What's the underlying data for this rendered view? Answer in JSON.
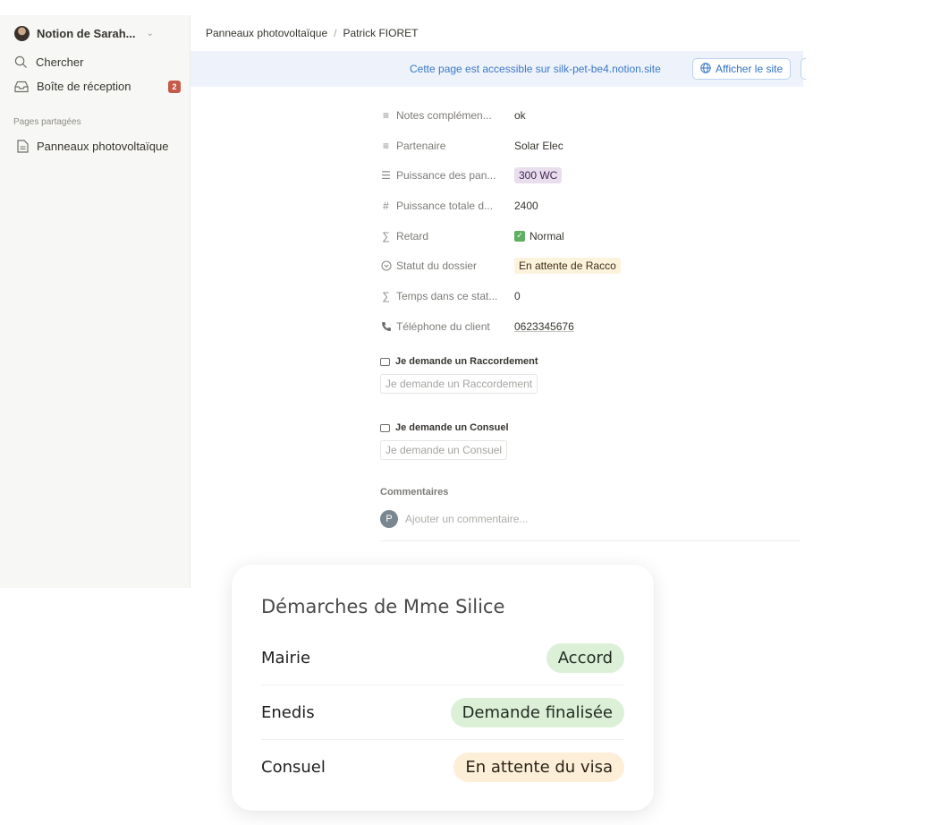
{
  "sidebar": {
    "workspace": "Notion de Sarah...",
    "search": "Chercher",
    "inbox": "Boîte de réception",
    "inbox_count": "2",
    "section": "Pages partagées",
    "page": "Panneaux photovoltaïque"
  },
  "breadcrumb": {
    "parent": "Panneaux photovoltaïque",
    "separator": "/",
    "current": "Patrick FIORET"
  },
  "banner": {
    "text": "Cette page est accessible sur silk-pet-be4.notion.site",
    "button": "Afficher le site"
  },
  "properties": [
    {
      "icon": "text-lines-icon",
      "name": "Notes complémen...",
      "value": "ok"
    },
    {
      "icon": "text-lines-icon",
      "name": "Partenaire",
      "value": "Solar Elec"
    },
    {
      "icon": "list-icon",
      "name": "Puissance des pan...",
      "value": "300 WC"
    },
    {
      "icon": "hash-icon",
      "name": "Puissance totale d...",
      "value": "2400"
    },
    {
      "icon": "sigma-icon",
      "name": "Retard",
      "value": "Normal"
    },
    {
      "icon": "status-icon",
      "name": "Statut du dossier",
      "value": "En attente de Racco"
    },
    {
      "icon": "sigma-icon",
      "name": "Temps dans ce stat...",
      "value": "0"
    },
    {
      "icon": "phone-icon",
      "name": "Téléphone du client",
      "value": "0623345676"
    }
  ],
  "buttons": [
    {
      "label": "Je demande un Raccordement",
      "action": "Je demande un Raccordement"
    },
    {
      "label": "Je demande un Consuel",
      "action": "Je demande un Consuel"
    }
  ],
  "comments": {
    "title": "Commentaires",
    "avatar": "P",
    "placeholder": "Ajouter un commentaire..."
  },
  "card": {
    "title": "Démarches de Mme Silice",
    "rows": [
      {
        "label": "Mairie",
        "status": "Accord",
        "color": "#dcf0d8"
      },
      {
        "label": "Enedis",
        "status": "Demande finalisée",
        "color": "#dcf0d8"
      },
      {
        "label": "Consuel",
        "status": "En attente du visa",
        "color": "#fdefd7"
      }
    ]
  }
}
